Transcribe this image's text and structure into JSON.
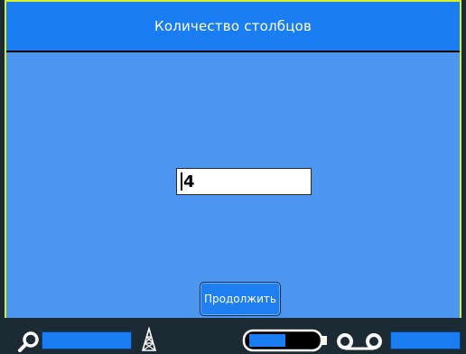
{
  "dialog": {
    "title": "Количество столбцов"
  },
  "input": {
    "value": "4"
  },
  "buttons": {
    "continue_label": "Продолжить"
  },
  "status": {
    "icons": [
      "search-icon",
      "tower-icon",
      "battery-icon",
      "tape-reel-icon"
    ]
  },
  "colors": {
    "background": "#4d96f0",
    "title_bar": "#1a7ef2",
    "frame_border": "#d6f02e",
    "status_bar": "#1c2a33"
  }
}
